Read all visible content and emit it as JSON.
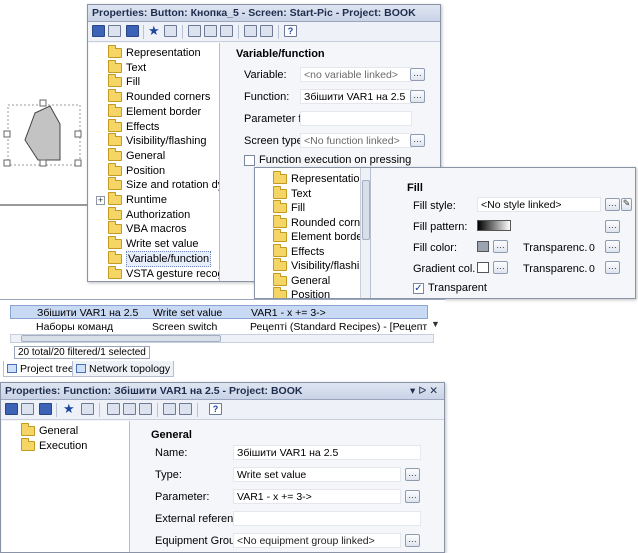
{
  "top_window": {
    "title": "Properties: Button: Кнопка_5 - Screen: Start-Pic - Project: BOOK",
    "tree": [
      "Representation",
      "Text",
      "Fill",
      "Rounded corners",
      "Element border",
      "Effects",
      "Visibility/flashing",
      "General",
      "Position",
      "Size and rotation dyr",
      "Runtime",
      "Authorization",
      "VBA macros",
      "Write set value",
      "Variable/function",
      "VSTA gesture recogr"
    ],
    "group": "Variable/function",
    "rows": [
      {
        "label": "Variable:",
        "value": "<no variable linked>"
      },
      {
        "label": "Function:",
        "value": "Збішити VAR1 на 2.5"
      },
      {
        "label": "Parameter f...",
        "value": ""
      },
      {
        "label": "Screen type...",
        "value": "<No function linked>"
      }
    ],
    "checkbox_label": "Function execution on pressing"
  },
  "fill_window": {
    "tree": [
      "Representation",
      "Text",
      "Fill",
      "Rounded corners",
      "Element border",
      "Effects",
      "Visibility/flashing",
      "General",
      "Position"
    ],
    "group": "Fill",
    "fill_style_label": "Fill style:",
    "fill_style_value": "<No style linked>",
    "fill_pattern_label": "Fill pattern:",
    "fill_color_label": "Fill color:",
    "gradient_label": "Gradient col...",
    "transparency_label": "Transparenc...",
    "transparency_value1": "0",
    "transparency_value2": "0",
    "transparent_label": "Transparent",
    "fill_color_swatch": "#9aa4b1"
  },
  "list_panel": {
    "rows": [
      {
        "name": "Збішити VAR1 на 2.5",
        "type": "Write set value",
        "param": "VAR1 - x += 3->"
      },
      {
        "name": "Наборы команд",
        "type": "Screen switch",
        "param": "Рецепті (Standard Recipes) - [Рецепт1]"
      }
    ],
    "status": "20 total/20 filtered/1 selected",
    "tabs": [
      "Project tree",
      "Network topology"
    ]
  },
  "bottom_window": {
    "title": "Properties: Function: Збішити VAR1 на 2.5 - Project: BOOK",
    "title_buttons": "▾ ᐅ ✕",
    "tree": [
      "General",
      "Execution"
    ],
    "group": "General",
    "rows": [
      {
        "label": "Name:",
        "value": "Збішити VAR1 на 2.5"
      },
      {
        "label": "Type:",
        "value": "Write set value"
      },
      {
        "label": "Parameter:",
        "value": "VAR1 - x += 3->"
      },
      {
        "label": "External referenc...",
        "value": ""
      },
      {
        "label": "Equipment Grou...",
        "value": "<No equipment group linked>"
      }
    ]
  }
}
